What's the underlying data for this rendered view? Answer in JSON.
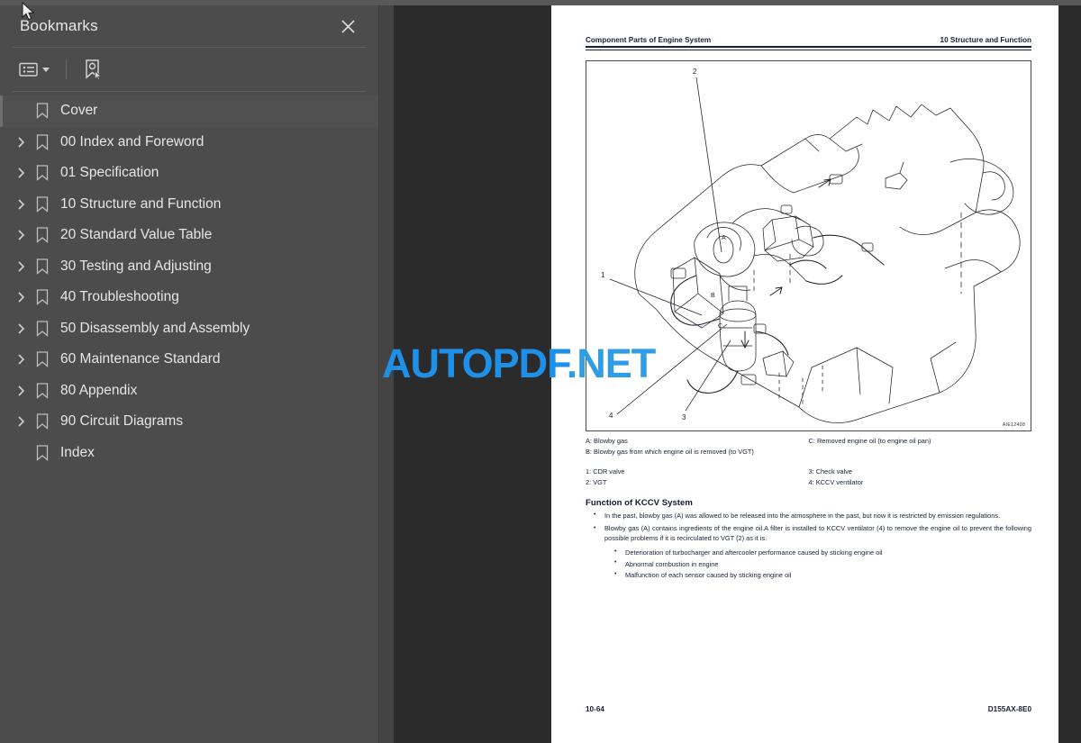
{
  "app": {
    "sidebar": {
      "title": "Bookmarks",
      "close_icon": "close-icon",
      "toolbar": {
        "list_options_icon": "list-options-icon",
        "add_bookmark_icon": "add-bookmark-icon"
      },
      "items": [
        {
          "label": "Cover",
          "expandable": false,
          "selected": true
        },
        {
          "label": "00 Index and Foreword",
          "expandable": true,
          "selected": false
        },
        {
          "label": "01 Specification",
          "expandable": true,
          "selected": false
        },
        {
          "label": "10 Structure and Function",
          "expandable": true,
          "selected": false
        },
        {
          "label": "20 Standard Value Table",
          "expandable": true,
          "selected": false
        },
        {
          "label": "30 Testing and Adjusting",
          "expandable": true,
          "selected": false
        },
        {
          "label": "40 Troubleshooting",
          "expandable": true,
          "selected": false
        },
        {
          "label": "50 Disassembly and Assembly",
          "expandable": true,
          "selected": false
        },
        {
          "label": "60 Maintenance Standard",
          "expandable": true,
          "selected": false
        },
        {
          "label": "80 Appendix",
          "expandable": true,
          "selected": false
        },
        {
          "label": "90 Circuit Diagrams",
          "expandable": true,
          "selected": false
        },
        {
          "label": "Index",
          "expandable": false,
          "selected": false
        }
      ]
    },
    "watermark": {
      "part1": "AUTOPDF",
      "part2": ".NET"
    },
    "document": {
      "header": {
        "left": "Component Parts of Engine System",
        "right": "10 Structure and Function"
      },
      "figure": {
        "id": "AIE12408",
        "alt": "engine-system-line-drawing"
      },
      "legend": {
        "left": [
          "A: Blowby gas",
          "B: Blowby gas from which engine oil is removed (to VGT)"
        ],
        "right": [
          "C: Removed engine oil (to engine oil pan)"
        ],
        "numbers_left": [
          "1: CDR valve",
          "2: VGT"
        ],
        "numbers_right": [
          "3: Check valve",
          "4: KCCV ventilator"
        ]
      },
      "section": {
        "title": "Function of KCCV System",
        "bullets": [
          "In the past, blowby gas (A) was allowed to be released into the atmosphere in the past, but now it is restricted by emission regulations.",
          "Blowby gas (A) contains ingredients of the engine oil.A filter is installed to KCCV ventilator (4) to remove the engine oil to prevent the following possible problems if it is recirculated to VGT (2) as it is."
        ],
        "subbullets": [
          "Deterioration of turbocharger and aftercooler performance caused by sticking engine oil",
          "Abnormal combustion in engine",
          "Malfunction of each sensor caused by sticking engine oil"
        ]
      },
      "footer": {
        "page_number": "10-64",
        "model_code": "D155AX-8E0"
      }
    }
  },
  "colors": {
    "sidebar_bg": "#4c4c4c",
    "viewer_bg": "#2b2b2b",
    "page_bg": "#ffffff",
    "watermark_blue": "#1e90e8",
    "text_light": "#e6e6e6",
    "doc_text": "#16213a"
  }
}
